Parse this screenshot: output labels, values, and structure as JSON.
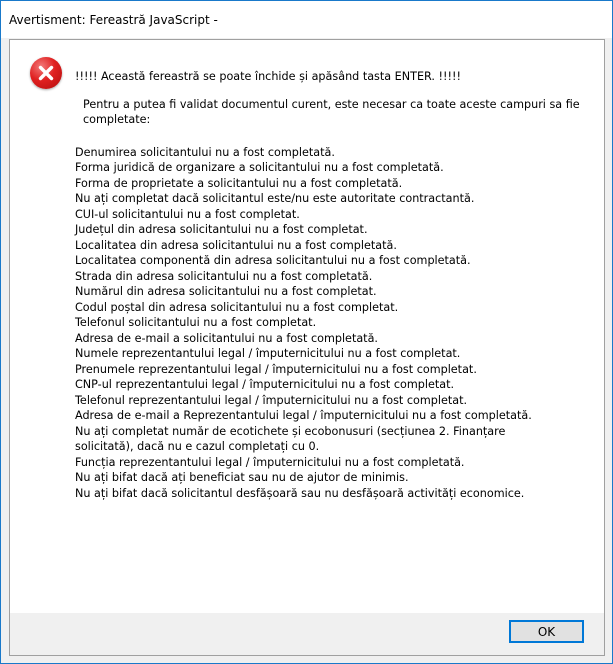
{
  "window": {
    "title": "Avertisment: Fereastră JavaScript -"
  },
  "dialog": {
    "icon": "error-icon",
    "enter_hint": "!!!!! Această fereastră se poate închide și apăsând tasta ENTER. !!!!!",
    "intro": "Pentru a putea fi validat documentul curent, este necesar ca toate aceste campuri sa fie completate:",
    "messages": [
      "Denumirea solicitantului nu a fost completată.",
      "Forma juridică de organizare a solicitantului nu a fost completată.",
      "Forma de proprietate a solicitantului nu a fost completată.",
      "Nu ați completat dacă solicitantul este/nu este autoritate contractantă.",
      "CUI-ul solicitantului nu a fost completat.",
      "Județul din adresa solicitantului nu a fost completat.",
      "Localitatea din adresa solicitantului nu a fost completată.",
      "Localitatea componentă din adresa solicitantului nu a fost completată.",
      "Strada din adresa solicitantului nu a fost completată.",
      "Numărul din adresa solicitantului nu a fost completat.",
      "Codul poștal din adresa solicitantului nu a fost completat.",
      "Telefonul solicitantului nu a fost completat.",
      "Adresa de e-mail a solicitantului nu a fost completată.",
      "Numele reprezentantului legal / împuternicitului nu a fost completat.",
      "Prenumele reprezentantului legal / împuternicitului nu a fost completat.",
      "CNP-ul reprezentantului legal / împuternicitului nu a fost completat.",
      "Telefonul reprezentantului legal / împuternicitului nu a fost completat.",
      "Adresa de e-mail a Reprezentantului legal / împuternicitului nu a fost completată.",
      "Nu ați completat număr de ecotichete și ecobonusuri (secțiunea 2. Finanțare\nsolicitată), dacă nu e cazul completați cu 0.",
      "Funcția reprezentantului legal / împuternicitului nu a fost completată.",
      "Nu ați bifat dacă ați beneficiat sau nu de ajutor de minimis.",
      "Nu ați bifat dacă solicitantul desfășoară sau nu desfășoară activități economice."
    ]
  },
  "buttons": {
    "ok_label": "OK"
  },
  "colors": {
    "window_border": "#1979ca",
    "error_red": "#e02020",
    "button_focus": "#0078d7"
  }
}
